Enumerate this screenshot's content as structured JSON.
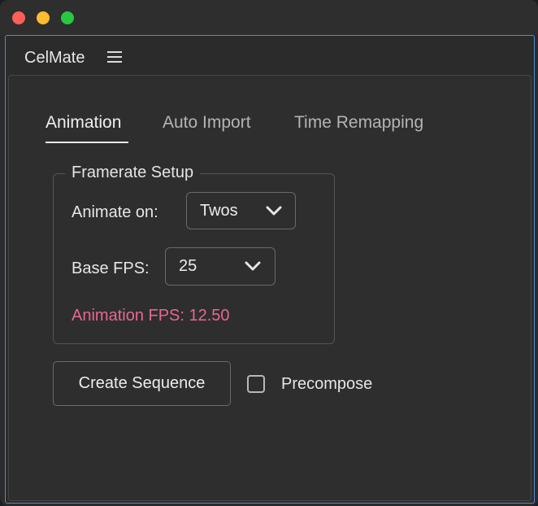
{
  "window": {
    "traffic_lights": {
      "close": "#ff5f57",
      "minimize": "#febc2e",
      "maximize": "#28c840"
    }
  },
  "panel": {
    "title": "CelMate",
    "menu_icon": "hamburger-menu-icon"
  },
  "tabs": [
    {
      "label": "Animation",
      "active": true
    },
    {
      "label": "Auto Import",
      "active": false
    },
    {
      "label": "Time Remapping",
      "active": false
    }
  ],
  "framerate": {
    "legend": "Framerate Setup",
    "animate_on": {
      "label": "Animate on:",
      "value": "Twos"
    },
    "base_fps": {
      "label": "Base FPS:",
      "value": "25"
    },
    "animation_fps_text": "Animation FPS: 12.50",
    "animation_fps_color": "#e8678e"
  },
  "actions": {
    "create_sequence_label": "Create Sequence",
    "precompose_label": "Precompose",
    "precompose_checked": false
  },
  "colors": {
    "accent_border": "#4a8fd4"
  }
}
